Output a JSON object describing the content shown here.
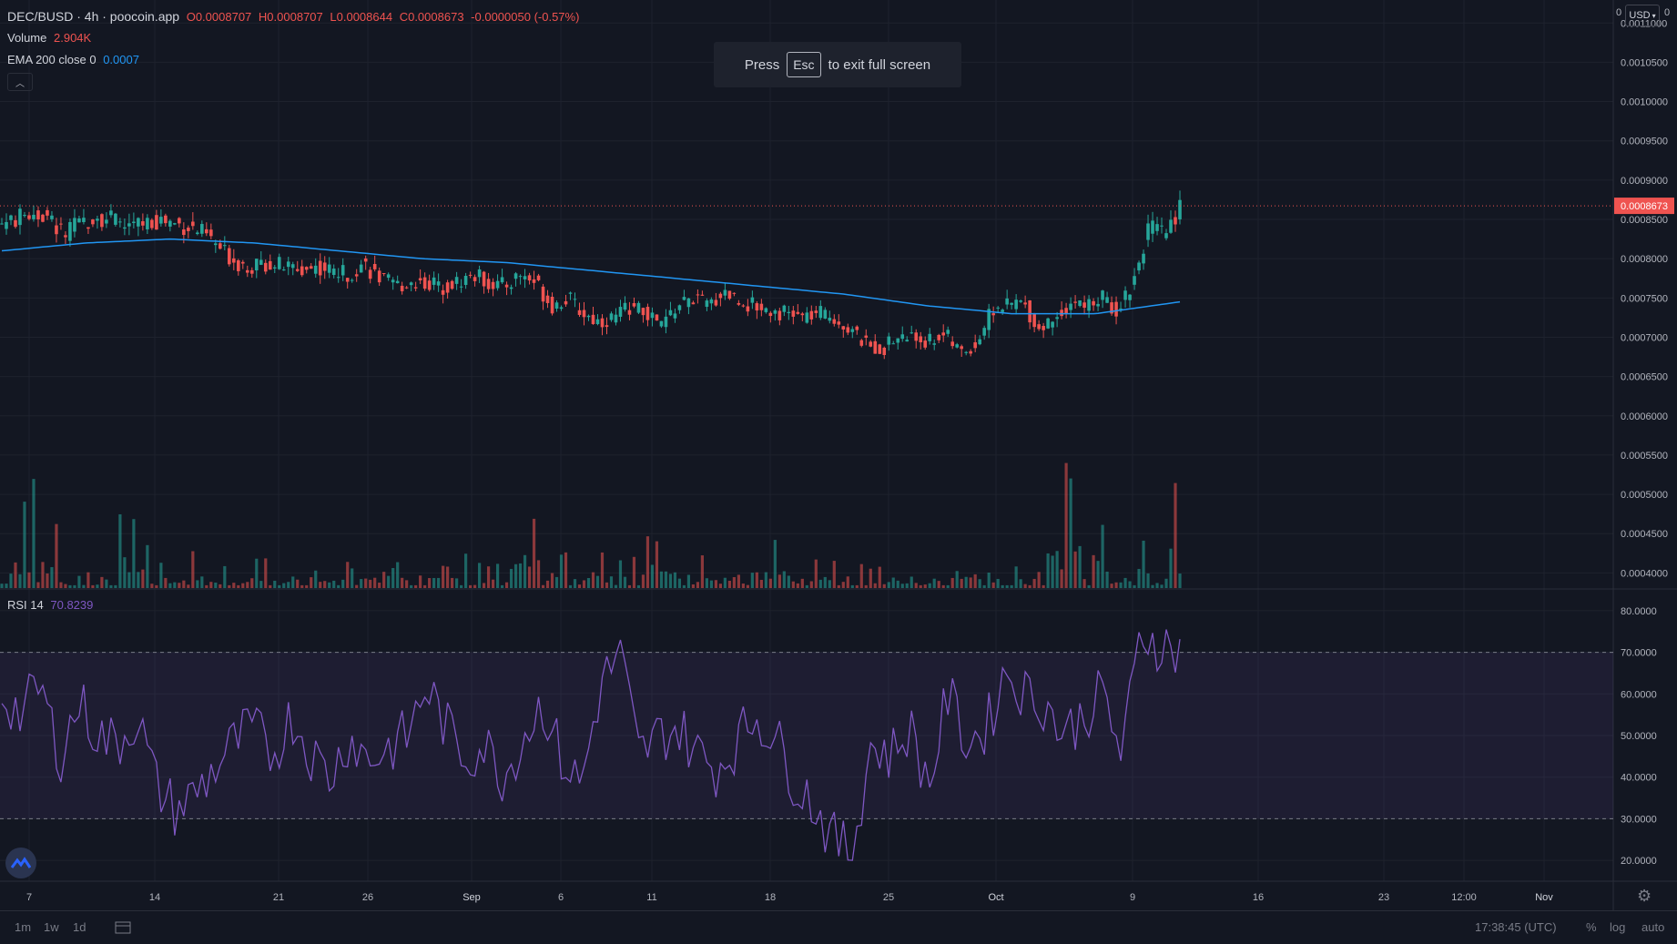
{
  "header": {
    "symbol": "DEC/BUSD · 4h · poocoin.app",
    "open": "O0.00087​07",
    "high": "H0.0008707",
    "low": "L0.0008644",
    "close": "C0.0008673",
    "change": "-0.0000050 (-0.57%)",
    "volume_label": "Volume",
    "volume_value": "2.904K",
    "ema_label": "EMA 200 close 0",
    "ema_value": "0.0007",
    "rsi_label": "RSI 14",
    "rsi_value": "70.8239"
  },
  "toast": {
    "before": "Press",
    "key": "Esc",
    "after": "to exit full screen"
  },
  "currency": "USD",
  "top_right_zero_a": "0",
  "top_right_zero_b": "0",
  "last_price_label": "0.0008673",
  "price_axis_labels": [
    "0.0011000",
    "0.0010500",
    "0.0010000",
    "0.0009500",
    "0.0009000",
    "0.0008500",
    "0.0008000",
    "0.0007500",
    "0.0007000",
    "0.0006500",
    "0.0006000",
    "0.0005500",
    "0.0005000",
    "0.0004500",
    "0.0004000"
  ],
  "rsi_axis_labels": [
    "80.0000",
    "70.0000",
    "60.0000",
    "50.0000",
    "40.0000",
    "30.0000",
    "20.0000"
  ],
  "time_axis_labels": [
    "7",
    "14",
    "21",
    "26",
    "Sep",
    "6",
    "11",
    "18",
    "25",
    "Oct",
    "9",
    "16",
    "23",
    "12:00",
    "Nov"
  ],
  "bottom_bar": {
    "tf_1m": "1m",
    "tf_1w": "1w",
    "tf_1d": "1d",
    "clock": "17:38:45 (UTC)",
    "percent": "%",
    "log": "log",
    "auto": "auto"
  },
  "colors": {
    "bg": "#131722",
    "up": "#26a69a",
    "down": "#ef5350",
    "ema": "#2196f3",
    "rsi": "#7e57c2",
    "grid": "#1e222d"
  },
  "chart_data": {
    "type": "candlestick",
    "price_range": [
      0.00039,
      0.00112
    ],
    "rsi_range": [
      15,
      85
    ],
    "rsi_bands": [
      30,
      70
    ],
    "price_anchors": [
      [
        0.000845,
        0.00085,
        0.00086,
        0.00085,
        0.00083,
        0.000845,
        0.000855,
        0.00085,
        0.00084,
        0.000845,
        0.00085,
        0.000845,
        0.00084,
        0.00083,
        0.00081,
        0.000795,
        0.00079,
        0.000795,
        0.00079,
        0.000785,
        0.00079,
        0.000785,
        0.00078,
        0.000795,
        0.000775,
        0.000765,
        0.00077,
        0.00077,
        0.000765,
        0.00077,
        0.00078,
        0.00077,
        0.000765,
        0.00078,
        0.00077,
        0.00074,
        0.00075,
        0.00073,
        0.00072,
        0.000725,
        0.00074,
        0.00073,
        0.000715,
        0.00074,
        0.00075,
        0.00074,
        0.00076,
        0.000745,
        0.00074,
        0.000735,
        0.00073,
        0.000725,
        0.00073,
        0.000725,
        0.00071,
        0.00069,
        0.000685,
        0.0007,
        0.0007,
        0.000695,
        0.000705,
        0.00068,
        0.00069,
        0.000735,
        0.00074,
        0.000745,
        0.00071,
        0.000725,
        0.000745,
        0.00074,
        0.00075,
        0.000735,
        0.00077,
        0.00084,
        0.00083,
        0.0008673
      ]
    ],
    "ema_anchors": [
      0.00081,
      0.00082,
      0.000825,
      0.00082,
      0.00081,
      0.0008,
      0.000795,
      0.000785,
      0.000775,
      0.000765,
      0.000755,
      0.00074,
      0.00073,
      0.00073,
      0.000745
    ],
    "rsi_anchors": [
      60,
      55,
      62,
      45,
      58,
      50,
      48,
      55,
      38,
      32,
      36,
      42,
      48,
      52,
      45,
      55,
      46,
      40,
      50,
      44,
      47,
      50,
      62,
      52,
      45,
      48,
      40,
      50,
      58,
      44,
      38,
      62,
      70,
      45,
      50,
      52,
      46,
      42,
      48,
      55,
      50,
      40,
      34,
      25,
      22,
      48,
      45,
      52,
      38,
      60,
      48,
      52,
      66,
      60,
      58,
      50,
      55,
      60,
      45,
      75,
      72,
      70
    ],
    "volume_anchors": [
      0.2,
      1.0,
      0.3,
      0.4,
      0.7,
      0.2,
      0.3,
      0.2,
      0.2,
      0.3,
      0.5,
      0.2,
      0.3,
      0.6,
      0.2,
      0.3,
      0.2,
      0.9,
      0.3,
      0.4,
      0.2,
      0.5,
      0.3,
      0.2,
      0.3,
      0.4,
      0.2,
      0.3,
      0.6,
      0.2,
      0.3,
      0.4,
      0.3,
      0.2,
      0.9,
      1.0,
      0.3,
      0.5,
      1.0
    ]
  }
}
